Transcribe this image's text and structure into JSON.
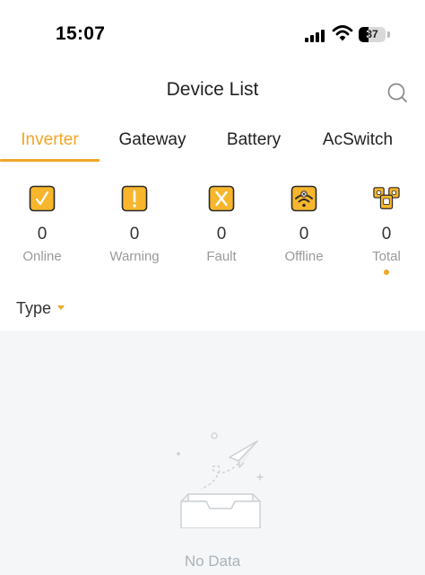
{
  "status_bar": {
    "time": "15:07",
    "battery": "37",
    "battery_level": 0.37
  },
  "header": {
    "title": "Device List",
    "search_icon": "search-icon"
  },
  "tabs": [
    {
      "label": "Inverter",
      "active": true
    },
    {
      "label": "Gateway",
      "active": false
    },
    {
      "label": "Battery",
      "active": false
    },
    {
      "label": "AcSwitch",
      "active": false
    }
  ],
  "stats": [
    {
      "icon": "online-check-icon",
      "count": "0",
      "label": "Online"
    },
    {
      "icon": "warning-exclamation-icon",
      "count": "0",
      "label": "Warning"
    },
    {
      "icon": "fault-x-icon",
      "count": "0",
      "label": "Fault"
    },
    {
      "icon": "offline-wifi-icon",
      "count": "0",
      "label": "Offline"
    },
    {
      "icon": "total-devices-icon",
      "count": "0",
      "label": "Total",
      "selected": true
    }
  ],
  "filter": {
    "label": "Type",
    "icon": "caret-down-icon"
  },
  "empty": {
    "text": "No Data",
    "icon": "empty-inbox-icon"
  },
  "colors": {
    "accent": "#f2a526",
    "icon_fill": "#f7b62b",
    "empty_bg": "#f5f6f7",
    "muted_text": "#9a9a9a"
  }
}
